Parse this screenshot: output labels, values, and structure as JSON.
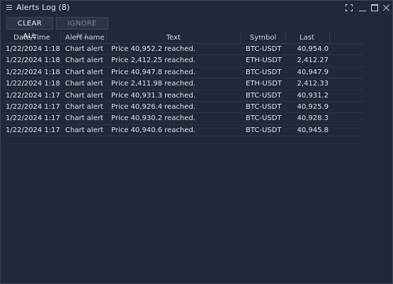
{
  "window": {
    "title": "Alerts Log (8)"
  },
  "toolbar": {
    "clear_all": "CLEAR ALL",
    "ignore_all": "IGNORE ALL"
  },
  "table": {
    "headers": [
      "Date/Time",
      "Alert name",
      "Text",
      "Symbol",
      "Last"
    ],
    "rows": [
      {
        "datetime": "1/22/2024  1:18...",
        "name": "Chart alert",
        "text": "Price 40,952.2 reached.",
        "symbol": "BTC-USDT",
        "last": "40,954.0"
      },
      {
        "datetime": "1/22/2024  1:18...",
        "name": "Chart alert",
        "text": "Price 2,412.25 reached.",
        "symbol": "ETH-USDT",
        "last": "2,412.27"
      },
      {
        "datetime": "1/22/2024  1:18...",
        "name": "Chart alert",
        "text": "Price 40,947.8 reached.",
        "symbol": "BTC-USDT",
        "last": "40,947.9"
      },
      {
        "datetime": "1/22/2024  1:18...",
        "name": "Chart alert",
        "text": "Price 2,411.98 reached.",
        "symbol": "ETH-USDT",
        "last": "2,412.33"
      },
      {
        "datetime": "1/22/2024  1:17...",
        "name": "Chart alert",
        "text": "Price 40,931.3 reached.",
        "symbol": "BTC-USDT",
        "last": "40,931.2"
      },
      {
        "datetime": "1/22/2024  1:17...",
        "name": "Chart alert",
        "text": "Price 40,926.4 reached.",
        "symbol": "BTC-USDT",
        "last": "40,925.9"
      },
      {
        "datetime": "1/22/2024  1:17...",
        "name": "Chart alert",
        "text": "Price 40,930.2 reached.",
        "symbol": "BTC-USDT",
        "last": "40,928.3"
      },
      {
        "datetime": "1/22/2024  1:17...",
        "name": "Chart alert",
        "text": "Price 40,940.6 reached.",
        "symbol": "BTC-USDT",
        "last": "40,945.8"
      }
    ]
  },
  "icons": {
    "menu": "hamburger-menu-icon",
    "expand": "expand-icon",
    "minimize": "minimize-icon",
    "maximize": "maximize-icon",
    "close": "close-icon"
  },
  "colors": {
    "background": "#1f2939",
    "border": "#3b4656",
    "button_bg": "#2c3545",
    "text": "#dde2e9",
    "text_muted": "#7c8594"
  }
}
